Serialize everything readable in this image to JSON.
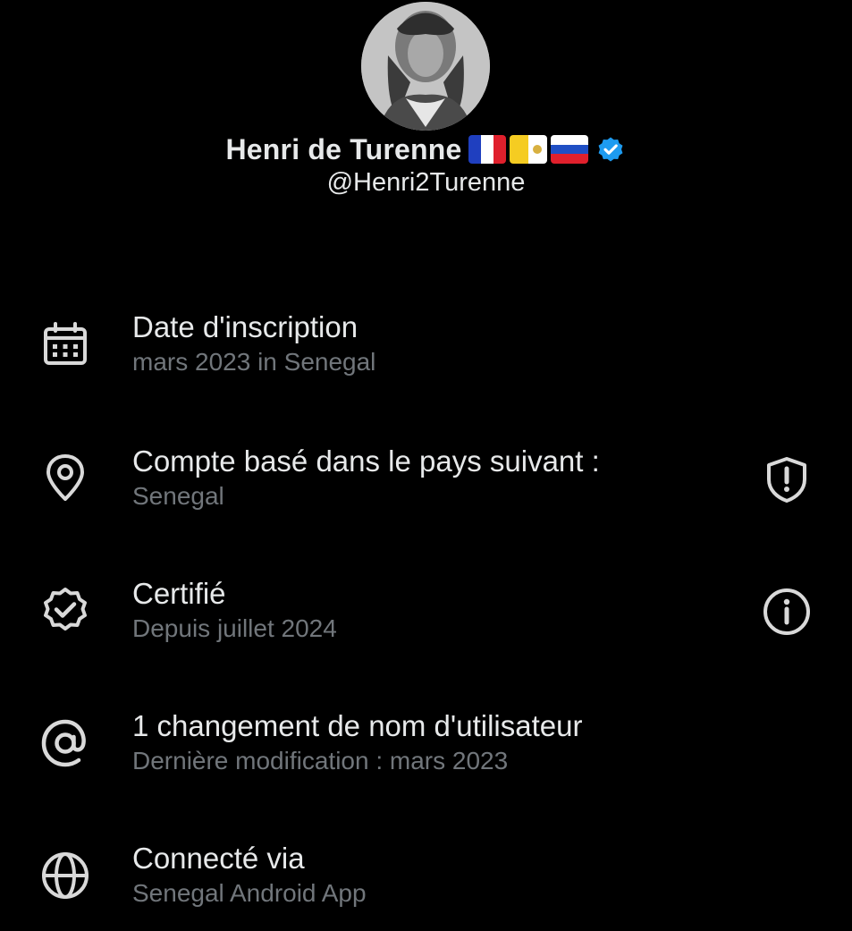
{
  "profile": {
    "display_name": "Henri de Turenne",
    "handle": "@Henri2Turenne",
    "flags": [
      "france-flag",
      "vatican-flag",
      "russia-flag"
    ],
    "verified": true,
    "verified_color": "#1d9bf0"
  },
  "about": {
    "items": [
      {
        "icon": "calendar-icon",
        "title": "Date d'inscription",
        "subtitle": "mars 2023 in Senegal"
      },
      {
        "icon": "location-pin-icon",
        "title": "Compte basé dans le pays suivant :",
        "subtitle": "Senegal",
        "trailing_icon": "shield-alert-icon"
      },
      {
        "icon": "verified-badge-icon",
        "title": "Certifié",
        "subtitle": "Depuis juillet 2024",
        "trailing_icon": "info-icon"
      },
      {
        "icon": "at-sign-icon",
        "title": "1 changement de nom d'utilisateur",
        "subtitle": "Dernière modification : mars 2023"
      },
      {
        "icon": "globe-icon",
        "title": "Connecté via",
        "subtitle": "Senegal Android App"
      }
    ]
  },
  "colors": {
    "background": "#000000",
    "primary_text": "#e7e9ea",
    "secondary_text": "#71767b",
    "icon": "#d9d9d9"
  }
}
